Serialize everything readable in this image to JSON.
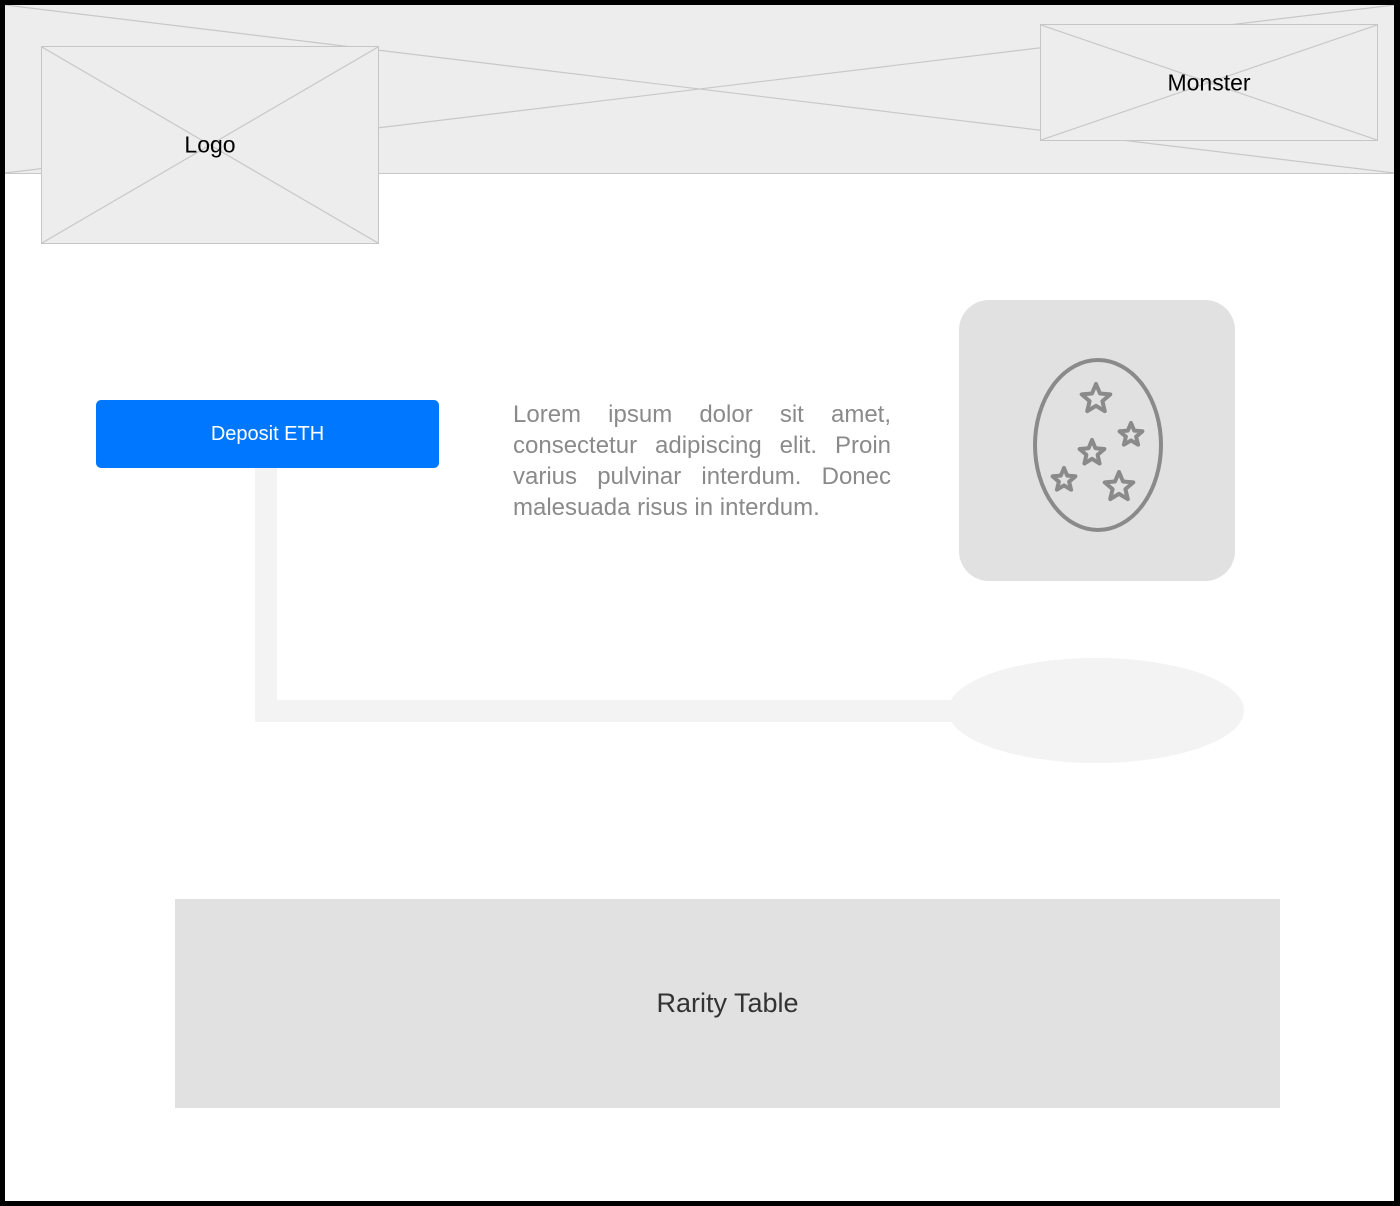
{
  "header": {
    "logo_label": "Logo",
    "monster_label": "Monster"
  },
  "main": {
    "deposit_button_label": "Deposit ETH",
    "description": "Lorem ipsum dolor sit amet, consectetur adipiscing elit. Proin varius pulvinar interdum. Donec malesuada risus in interdum.",
    "egg_icon": "egg-with-stars-icon"
  },
  "rarity_table": {
    "label": "Rarity Table"
  },
  "colors": {
    "accent": "#0077ff",
    "placeholder_bg": "#ededed",
    "panel_bg": "#e1e1e1",
    "text_muted": "#8a8a8a"
  }
}
